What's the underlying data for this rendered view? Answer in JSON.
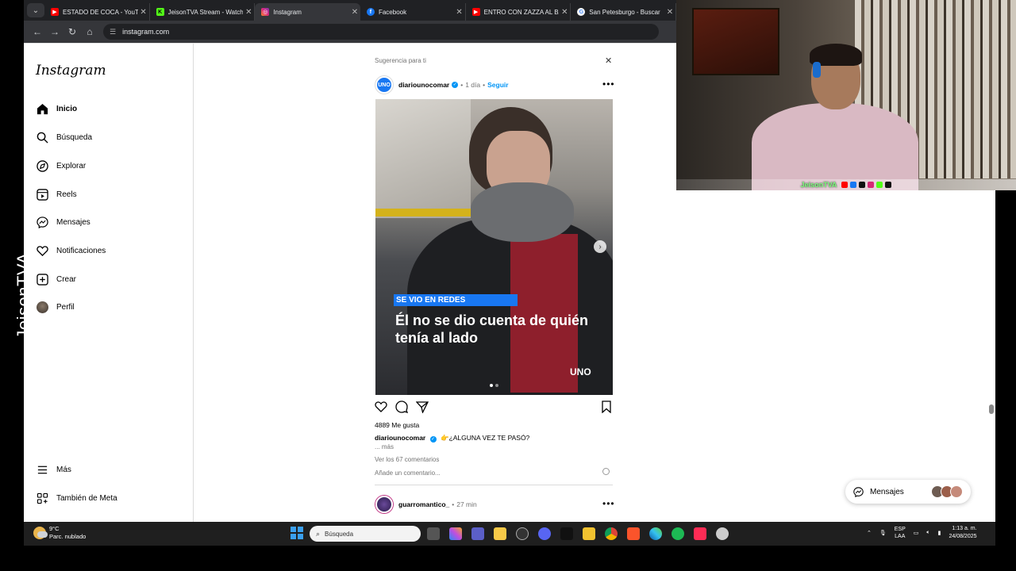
{
  "watermark": "JeisonTVA",
  "browser": {
    "tabs": [
      {
        "label": "ESTADO DE COCA - YouTube",
        "icon": "youtube-icon",
        "color": "#ff0000"
      },
      {
        "label": "JeisonTVA Stream - Watch",
        "icon": "kick-icon",
        "color": "#53fc18"
      },
      {
        "label": "Instagram",
        "icon": "instagram-icon",
        "color": "#d62976",
        "active": true
      },
      {
        "label": "Facebook",
        "icon": "facebook-icon",
        "color": "#1877f2"
      },
      {
        "label": "ENTRO CON ZAZZA AL BA",
        "icon": "youtube-icon",
        "color": "#ff0000"
      },
      {
        "label": "San Petesburgo - Buscar",
        "icon": "google-icon",
        "color": "#ffffff"
      }
    ],
    "url": "instagram.com"
  },
  "sidebar": {
    "logo": "Instagram",
    "items": [
      {
        "label": "Inicio",
        "icon": "home-icon"
      },
      {
        "label": "Búsqueda",
        "icon": "search-icon"
      },
      {
        "label": "Explorar",
        "icon": "compass-icon"
      },
      {
        "label": "Reels",
        "icon": "reels-icon"
      },
      {
        "label": "Mensajes",
        "icon": "messenger-icon"
      },
      {
        "label": "Notificaciones",
        "icon": "heart-icon"
      },
      {
        "label": "Crear",
        "icon": "plus-square-icon"
      },
      {
        "label": "Perfil",
        "icon": "profile-avatar"
      }
    ],
    "bottom_items": [
      {
        "label": "Más",
        "icon": "menu-icon"
      },
      {
        "label": "También de Meta",
        "icon": "meta-grid-icon"
      }
    ]
  },
  "feed": {
    "suggestion_label": "Sugerencia para ti",
    "post": {
      "avatar_text": "UNO",
      "username": "diariounocomar",
      "time": "1 día",
      "follow": "Seguir",
      "media": {
        "tag": "SE VIO EN REDES",
        "headline": "Él no se dio cuenta de quién tenía al lado",
        "brand": "UNO"
      },
      "likes": "4889 Me gusta",
      "caption_user": "diariounocomar",
      "caption_text": "👉¿ALGUNA VEZ TE PASÓ?",
      "more": "... más",
      "comments": "Ver los 67 comentarios",
      "add_comment_placeholder": "Añade un comentario..."
    },
    "next_post": {
      "username": "guarromantico_",
      "time": "27 min"
    }
  },
  "messages_bubble": {
    "label": "Mensajes"
  },
  "webcam": {
    "overlay_name": "JeisonTVA"
  },
  "taskbar": {
    "weather_temp": "9°C",
    "weather_desc": "Parc. nublado",
    "search_placeholder": "Búsqueda",
    "lang_1": "ESP",
    "lang_2": "LAA",
    "time": "1:13 a. m.",
    "date": "24/08/2025"
  }
}
